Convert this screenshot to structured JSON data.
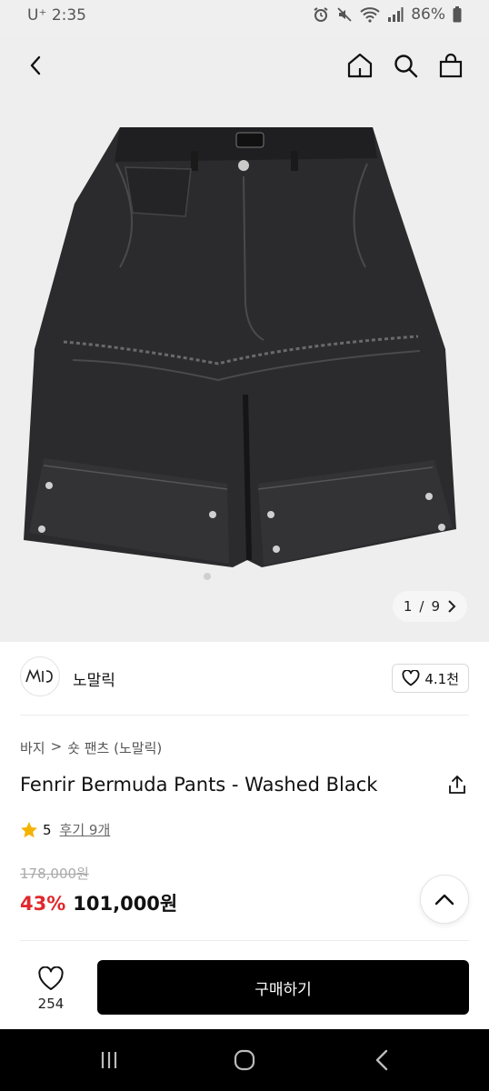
{
  "status": {
    "carrier_time": "U⁺ 2:35",
    "battery": "86%"
  },
  "nav": {
    "back_icon": "chevron-left-icon",
    "home_icon": "home-icon",
    "search_icon": "search-icon",
    "bag_icon": "shopping-bag-icon"
  },
  "gallery": {
    "current": "1",
    "total": "9",
    "separator": "/"
  },
  "brand": {
    "name": "노말릭",
    "likes": "4.1천"
  },
  "product": {
    "breadcrumb": [
      "바지",
      ">",
      "숏 팬츠 (노말릭)"
    ],
    "title": "Fenrir Bermuda Pants - Washed Black",
    "rating": "5",
    "reviews": "후기 9개",
    "original_price": "178,000원",
    "discount": "43%",
    "price": "101,000원"
  },
  "actions": {
    "wish_count": "254",
    "buy_label": "구매하기"
  },
  "colors": {
    "accent": "#e0282d",
    "star": "#f5b301",
    "buy_button": "#000000"
  }
}
